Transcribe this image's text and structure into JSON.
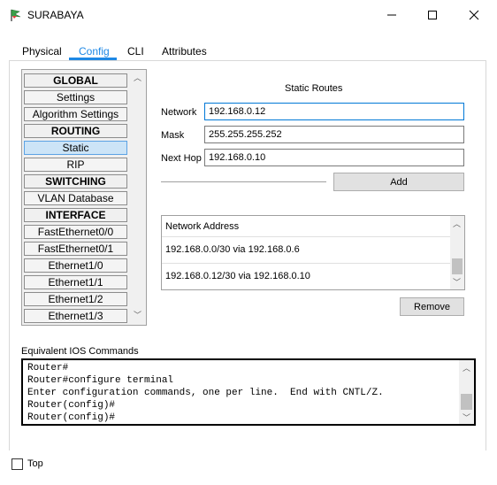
{
  "window": {
    "title": "SURABAYA",
    "minimize": "—",
    "maximize": "☐",
    "close": "✕"
  },
  "tabs": [
    {
      "label": "Physical"
    },
    {
      "label": "Config"
    },
    {
      "label": "CLI"
    },
    {
      "label": "Attributes"
    }
  ],
  "sidebar": {
    "items": [
      {
        "label": "GLOBAL"
      },
      {
        "label": "Settings"
      },
      {
        "label": "Algorithm Settings"
      },
      {
        "label": "ROUTING"
      },
      {
        "label": "Static"
      },
      {
        "label": "RIP"
      },
      {
        "label": "SWITCHING"
      },
      {
        "label": "VLAN Database"
      },
      {
        "label": "INTERFACE"
      },
      {
        "label": "FastEthernet0/0"
      },
      {
        "label": "FastEthernet0/1"
      },
      {
        "label": "Ethernet1/0"
      },
      {
        "label": "Ethernet1/1"
      },
      {
        "label": "Ethernet1/2"
      },
      {
        "label": "Ethernet1/3"
      }
    ]
  },
  "static_routes": {
    "title": "Static Routes",
    "network_label": "Network",
    "network_value": "192.168.0.12",
    "mask_label": "Mask",
    "mask_value": "255.255.255.252",
    "next_hop_label": "Next Hop",
    "next_hop_value": "192.168.0.10",
    "add_label": "Add",
    "table_header": "Network Address",
    "rows": [
      {
        "text": "192.168.0.0/30 via 192.168.0.6"
      },
      {
        "text": "192.168.0.12/30 via 192.168.0.10"
      }
    ],
    "remove_label": "Remove"
  },
  "ios": {
    "label": "Equivalent IOS Commands",
    "lines": [
      {
        "text": "Router#"
      },
      {
        "text": "Router#configure terminal"
      },
      {
        "text": "Enter configuration commands, one per line.  End with CNTL/Z."
      },
      {
        "text": "Router(config)#"
      },
      {
        "text": "Router(config)#"
      }
    ]
  },
  "footer": {
    "top_label": "Top",
    "top_checked": false
  },
  "colors": {
    "accent": "#1e88e5",
    "selected": "#cce4f7"
  }
}
